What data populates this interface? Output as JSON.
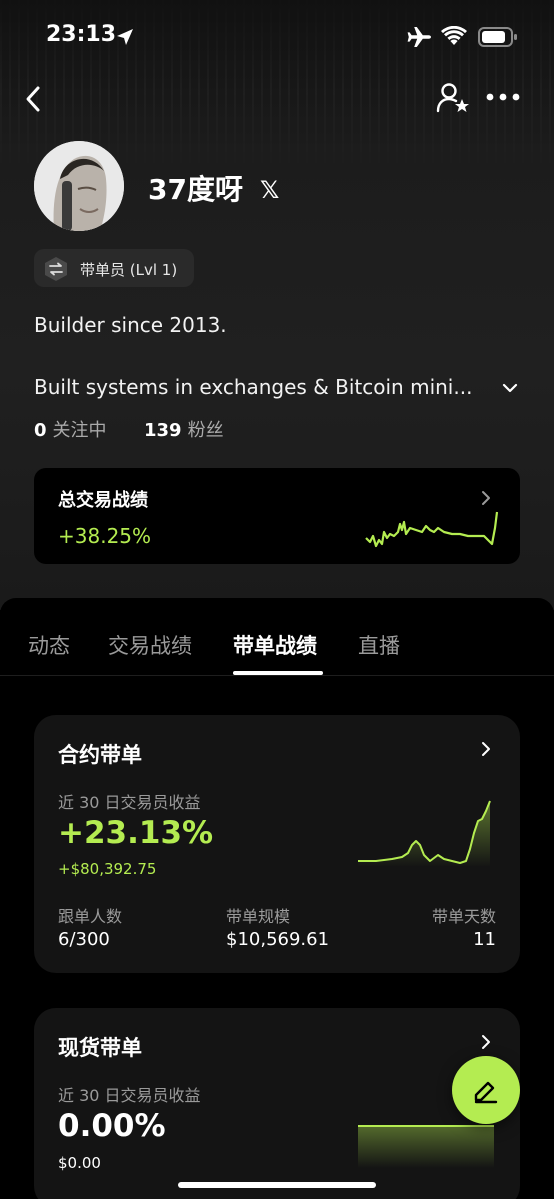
{
  "status_bar": {
    "time": "23:13"
  },
  "profile": {
    "name": "37度呀",
    "badge": "带单员 (Lvl 1)",
    "bio_line1": "Builder since 2013.",
    "bio_line2": "Built systems in exchanges & Bitcoin mini...",
    "following_count": "0",
    "following_label": "关注中",
    "followers_count": "139",
    "followers_label": "粉丝"
  },
  "total_trading": {
    "title": "总交易战绩",
    "value": "+38.25%"
  },
  "tabs": [
    {
      "label": "动态"
    },
    {
      "label": "交易战绩"
    },
    {
      "label": "带单战绩"
    },
    {
      "label": "直播"
    }
  ],
  "active_tab_index": 2,
  "contract_card": {
    "title": "合约带单",
    "subtitle": "近 30 日交易员收益",
    "pnl_percent": "+23.13%",
    "pnl_amount": "+$80,392.75",
    "stats": [
      {
        "label": "跟单人数",
        "value": "6/300"
      },
      {
        "label": "带单规模",
        "value": "$10,569.61"
      },
      {
        "label": "带单天数",
        "value": "11"
      }
    ]
  },
  "spot_card": {
    "title": "现货带单",
    "subtitle": "近 30 日交易员收益",
    "pnl_percent": "0.00%",
    "pnl_amount": "$0.00"
  },
  "colors": {
    "accent_green": "#b4ec51",
    "background": "#000000",
    "card": "#141414",
    "muted_text": "#9a9a9a"
  }
}
